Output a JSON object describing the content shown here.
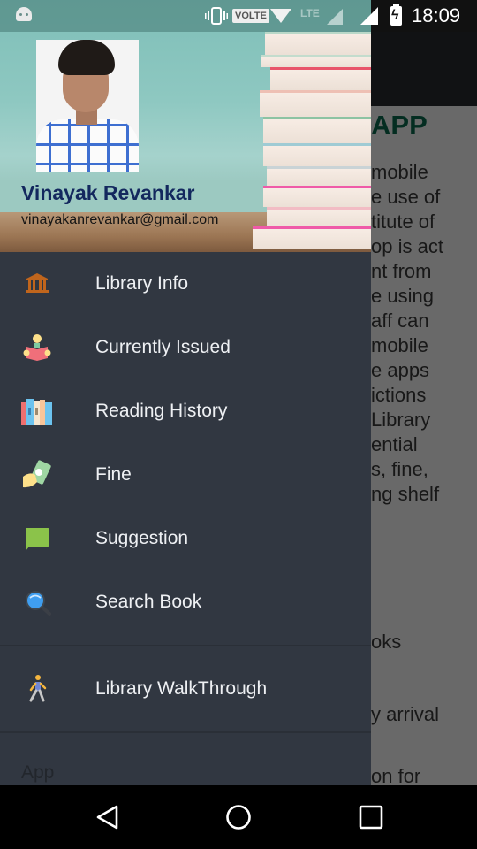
{
  "status_bar": {
    "time": "18:09",
    "volte_label": "VOLTE",
    "lte_label": "LTE"
  },
  "background_app": {
    "title_fragment": "APP",
    "text_fragments": [
      "mobile",
      "e use of",
      "titute of",
      "op is act",
      "nt from",
      "e using",
      "aff can",
      " mobile",
      "e apps",
      "ictions",
      "Library",
      "ential",
      "s, fine,",
      "ng shelf"
    ],
    "lower_fragments": [
      "oks",
      "y arrival",
      "on  for"
    ]
  },
  "drawer": {
    "header": {
      "user_name": "Vinayak Revankar",
      "user_email": "vinayakanrevankar@gmail.com"
    },
    "menu_items": [
      {
        "label": "Library Info",
        "icon": "library-building-icon"
      },
      {
        "label": "Currently Issued",
        "icon": "reading-person-icon"
      },
      {
        "label": "Reading History",
        "icon": "bookshelf-icon"
      },
      {
        "label": "Fine",
        "icon": "money-hand-icon"
      },
      {
        "label": "Suggestion",
        "icon": "chat-bubble-icon"
      },
      {
        "label": "Search Book",
        "icon": "magnifier-icon"
      }
    ],
    "secondary_items": [
      {
        "label": "Library WalkThrough",
        "icon": "walking-person-icon"
      }
    ],
    "section_label": "App"
  },
  "nav_bar": {
    "back": "back",
    "home": "home",
    "recents": "recents"
  },
  "colors": {
    "drawer_bg": "#313741",
    "menu_text": "#eef0f3",
    "user_name": "#13285e",
    "accent_title": "#0b6b4f"
  }
}
